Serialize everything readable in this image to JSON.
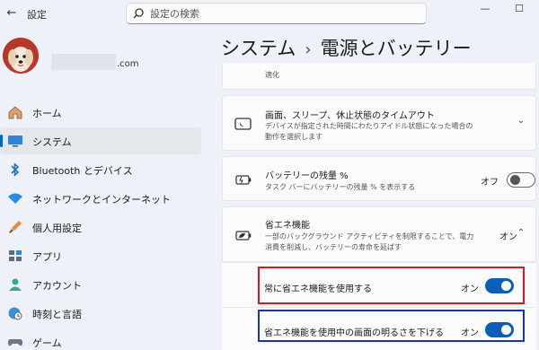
{
  "window": {
    "title": "設定",
    "back_glyph": "←",
    "minimize_glyph": "—",
    "maximize_glyph": "☐"
  },
  "search": {
    "placeholder": "設定の検索"
  },
  "account": {
    "domain": ".com"
  },
  "nav": {
    "items": [
      {
        "label": "ホーム",
        "icon": "home-icon"
      },
      {
        "label": "システム",
        "icon": "system-icon",
        "selected": true
      },
      {
        "label": "Bluetooth とデバイス",
        "icon": "bluetooth-icon"
      },
      {
        "label": "ネットワークとインターネット",
        "icon": "wifi-icon"
      },
      {
        "label": "個人用設定",
        "icon": "brush-icon"
      },
      {
        "label": "アプリ",
        "icon": "apps-icon"
      },
      {
        "label": "アカウント",
        "icon": "account-icon"
      },
      {
        "label": "時刻と言語",
        "icon": "globe-clock-icon"
      },
      {
        "label": "ゲーム",
        "icon": "gamepad-icon"
      }
    ]
  },
  "breadcrumb": {
    "parent": "システム",
    "separator": "›",
    "current": "電源とバッテリー"
  },
  "cards": {
    "top_fragment": "適化",
    "sleep": {
      "title": "画面、スリープ、休止状態のタイムアウト",
      "description": "デバイスが指定された時間にわたりアイドル状態になった場合の動作を選択します",
      "chevron": "⌄"
    },
    "battery_percent": {
      "title": "バッテリーの残量 %",
      "description": "タスク バーにバッテリーの残量 % を表示する",
      "toggle_label": "オフ",
      "toggle_on": false
    },
    "energy_saver": {
      "title": "省エネ機能",
      "description": "一部のバックグラウンド アクティビティを制限することで、電力消費を削減し、バッテリーの寿命を延ばす",
      "state_label": "オン",
      "chevron": "⌃",
      "sub_items": [
        {
          "label": "常に省エネ機能を使用する",
          "toggle_label": "オン",
          "toggle_on": true
        },
        {
          "label": "省エネ機能を使用中の画面の明るさを下げる",
          "toggle_label": "オン",
          "toggle_on": true
        }
      ]
    }
  },
  "colors": {
    "accent": "#0a5fb8",
    "highlight_red": "#e0141a",
    "highlight_blue": "#1631c9"
  }
}
